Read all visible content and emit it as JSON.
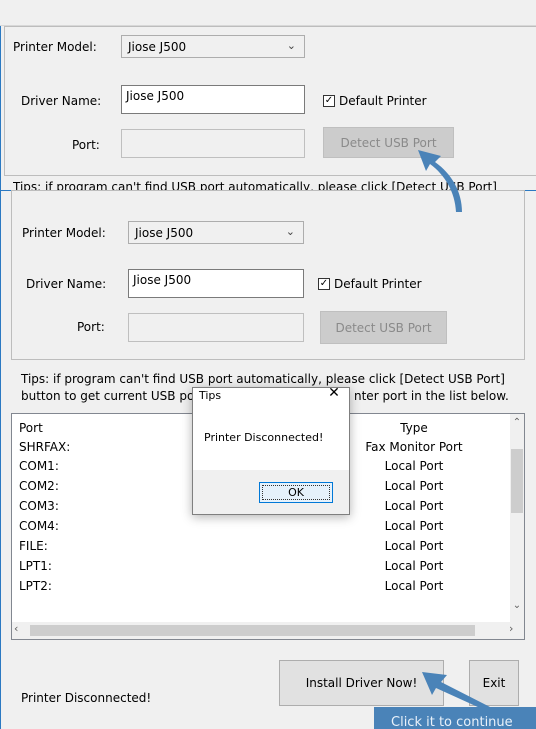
{
  "back": {
    "printer_model_label": "Printer Model:",
    "printer_model_value": "Jiose J500",
    "driver_name_label": "Driver Name:",
    "driver_name_value": "Jiose J500",
    "default_printer_label": "Default Printer",
    "port_label": "Port:",
    "detect_button": "Detect USB Port",
    "tips_partial": "Tips: if program can't find USB port automatically, please click [Detect USB Port]"
  },
  "front": {
    "printer_model_label": "Printer Model:",
    "printer_model_value": "Jiose J500",
    "driver_name_label": "Driver Name:",
    "driver_name_value": "Jiose J500",
    "default_printer_label": "Default Printer",
    "port_label": "Port:",
    "detect_button": "Detect USB Port",
    "tips_line1": "Tips: if program can't find USB port automatically, please click [Detect USB Port]",
    "tips_line2_a": "button to get current USB po",
    "tips_line2_b": "nter port in the list below.",
    "list": {
      "col_port": "Port",
      "col_type": "Type",
      "rows": [
        {
          "port": "SHRFAX:",
          "type": "Fax Monitor Port"
        },
        {
          "port": "COM1:",
          "type": "Local Port"
        },
        {
          "port": "COM2:",
          "type": "Local Port"
        },
        {
          "port": "COM3:",
          "type": "Local Port"
        },
        {
          "port": "COM4:",
          "type": "Local Port"
        },
        {
          "port": "FILE:",
          "type": "Local Port"
        },
        {
          "port": "LPT1:",
          "type": "Local Port"
        },
        {
          "port": "LPT2:",
          "type": "Local Port"
        }
      ]
    },
    "install_button": "Install Driver Now!",
    "exit_button": "Exit",
    "status": "Printer Disconnected!"
  },
  "dialog": {
    "title": "Tips",
    "message": "Printer Disconnected!",
    "ok": "OK"
  },
  "callout": {
    "text": "Click it to continue"
  },
  "colors": {
    "accent": "#4a83b8",
    "window_border": "#2b79c2",
    "dialog_ok_border": "#0078d7"
  }
}
